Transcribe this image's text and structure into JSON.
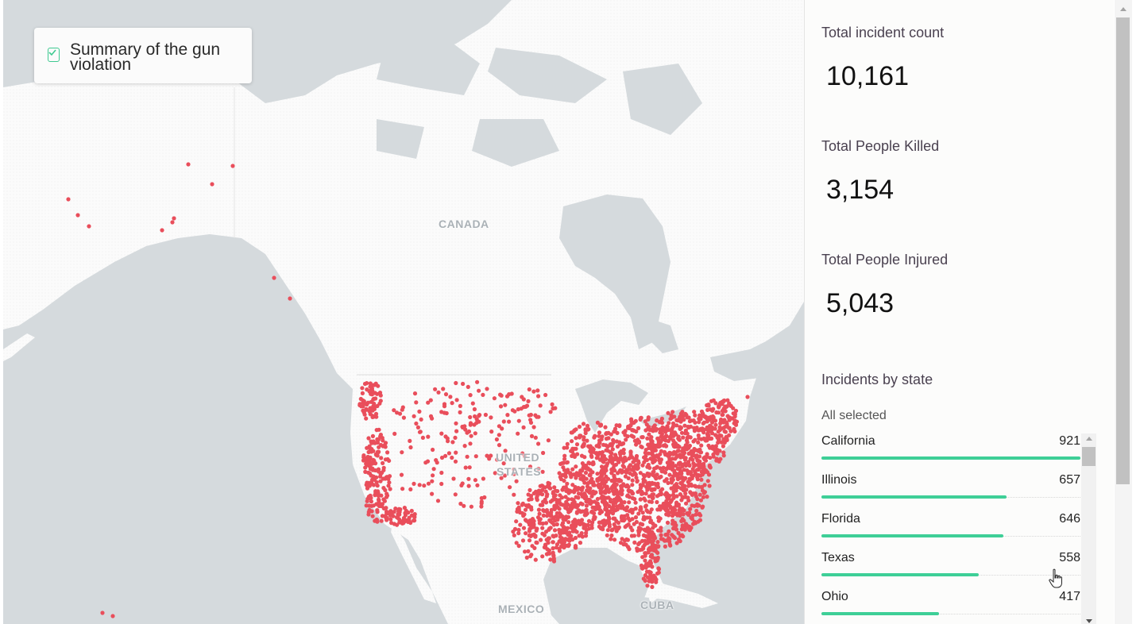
{
  "map": {
    "labels": {
      "canada": "CANADA",
      "united": "UNITED",
      "states": "STATES",
      "mexico": "MEXICO",
      "cuba": "CUBA"
    },
    "colors": {
      "water": "#d5dadd",
      "land": "#fbfbfb",
      "incident_dot": "#e94e5b"
    }
  },
  "layer_panel": {
    "title": "Summary of the gun violation",
    "checked": true,
    "check_icon": "checkbox-checked-icon"
  },
  "stats": {
    "incident_label": "Total incident count",
    "incident_value": "10,161",
    "killed_label": "Total People Killed",
    "killed_value": "3,154",
    "injured_label": "Total People Injured",
    "injured_value": "5,043",
    "by_state_title": "Incidents by state",
    "filter_status": "All selected",
    "bar_color": "#3ecf97",
    "states": [
      {
        "name": "California",
        "value": "921",
        "count": 921
      },
      {
        "name": "Illinois",
        "value": "657",
        "count": 657
      },
      {
        "name": "Florida",
        "value": "646",
        "count": 646
      },
      {
        "name": "Texas",
        "value": "558",
        "count": 558
      },
      {
        "name": "Ohio",
        "value": "417",
        "count": 417
      }
    ]
  }
}
